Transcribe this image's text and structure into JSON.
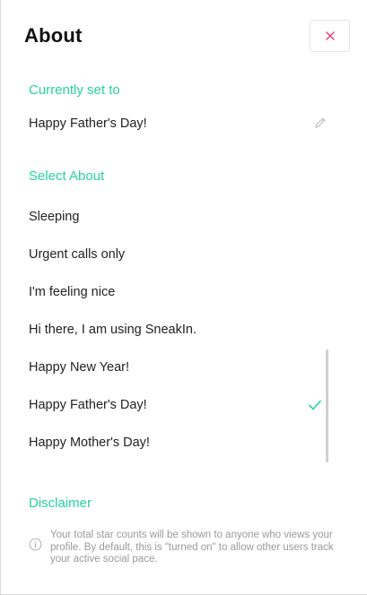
{
  "header": {
    "title": "About"
  },
  "current": {
    "heading": "Currently set to",
    "value": "Happy Father's Day!"
  },
  "select": {
    "heading": "Select About",
    "options": [
      "Sleeping",
      "Urgent calls only",
      "I'm feeling nice",
      "Hi there, I am using SneakIn.",
      "Happy New Year!",
      "Happy Father's Day!",
      "Happy Mother's Day!"
    ],
    "selected_index": 5
  },
  "disclaimer": {
    "heading": "Disclaimer",
    "text": "Your total star counts will be shown to anyone who views your profile. By default, this is \"turned on\" to allow other users track your active social pace."
  },
  "colors": {
    "accent": "#27d3a0",
    "close": "#e0457b"
  },
  "icons": {
    "close": "close-icon",
    "edit": "pencil-icon",
    "check": "check-icon",
    "info": "info-icon"
  }
}
